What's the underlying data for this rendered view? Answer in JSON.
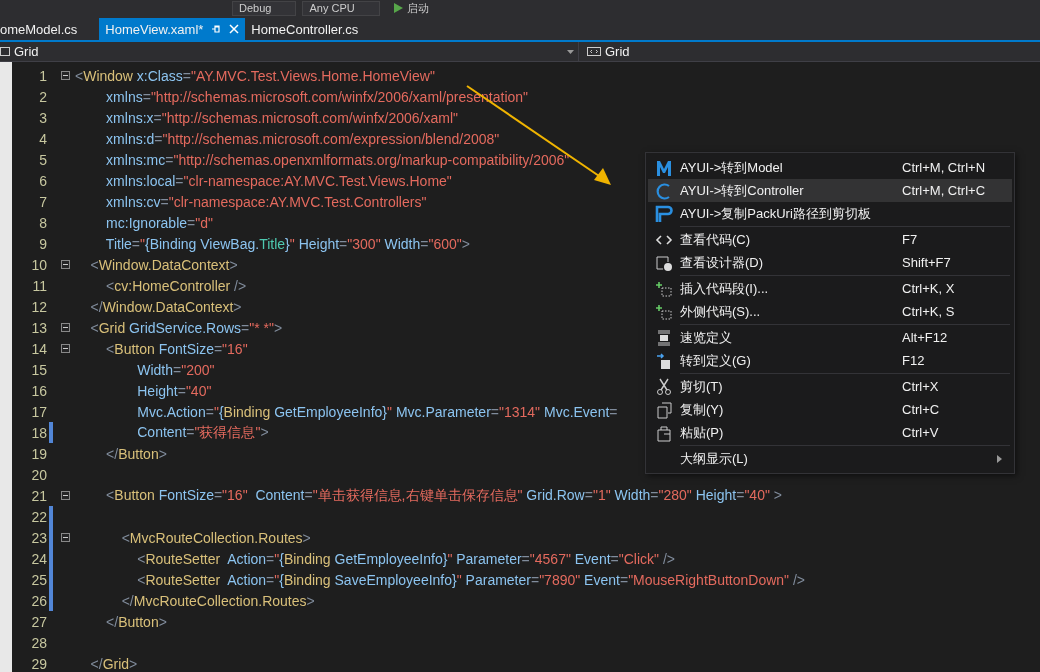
{
  "toolbar": {
    "items": [
      {
        "kind": "dropdown",
        "label": "Debug"
      },
      {
        "kind": "dropdown",
        "label": "Any CPU"
      },
      {
        "kind": "run",
        "label": "启动"
      }
    ]
  },
  "tabs": [
    {
      "label": "omeModel.cs",
      "selected": false
    },
    {
      "label": "HomeView.xaml*",
      "selected": true
    },
    {
      "label": "HomeController.cs",
      "selected": false
    }
  ],
  "breadcrumb": {
    "left": "Grid",
    "right": "Grid"
  },
  "code_lines": [
    {
      "num": "1",
      "fold": true,
      "changed": false,
      "tokens": [
        {
          "kind": "punct",
          "text": "<"
        },
        {
          "kind": "tag",
          "text": "Window"
        },
        {
          "kind": "attr",
          "text": " x:Class"
        },
        {
          "kind": "punct",
          "text": "="
        },
        {
          "kind": "value",
          "text": "\"AY.MVC.Test.Views.Home.HomeView\""
        }
      ]
    },
    {
      "num": "2",
      "fold": false,
      "changed": false,
      "tokens": [
        {
          "kind": "attr",
          "text": "        xmlns"
        },
        {
          "kind": "punct",
          "text": "="
        },
        {
          "kind": "value",
          "text": "\"http://schemas.microsoft.com/winfx/2006/xaml/presentation\""
        }
      ]
    },
    {
      "num": "3",
      "fold": false,
      "changed": false,
      "tokens": [
        {
          "kind": "attr",
          "text": "        xmlns:x"
        },
        {
          "kind": "punct",
          "text": "="
        },
        {
          "kind": "value",
          "text": "\"http://schemas.microsoft.com/winfx/2006/xaml\""
        }
      ]
    },
    {
      "num": "4",
      "fold": false,
      "changed": false,
      "tokens": [
        {
          "kind": "attr",
          "text": "        xmlns:d"
        },
        {
          "kind": "punct",
          "text": "="
        },
        {
          "kind": "value",
          "text": "\"http://schemas.microsoft.com/expression/blend/2008\""
        }
      ]
    },
    {
      "num": "5",
      "fold": false,
      "changed": false,
      "tokens": [
        {
          "kind": "attr",
          "text": "        xmlns:mc"
        },
        {
          "kind": "punct",
          "text": "="
        },
        {
          "kind": "value",
          "text": "\"http://schemas.openxmlformats.org/markup-compatibility/2006\""
        }
      ]
    },
    {
      "num": "6",
      "fold": false,
      "changed": false,
      "tokens": [
        {
          "kind": "attr",
          "text": "        xmlns:local"
        },
        {
          "kind": "punct",
          "text": "="
        },
        {
          "kind": "value",
          "text": "\"clr-namespace:AY.MVC.Test.Views.Home\""
        }
      ]
    },
    {
      "num": "7",
      "fold": false,
      "changed": false,
      "tokens": [
        {
          "kind": "attr",
          "text": "        xmlns:cv"
        },
        {
          "kind": "punct",
          "text": "="
        },
        {
          "kind": "value",
          "text": "\"clr-namespace:AY.MVC.Test.Controllers\""
        }
      ]
    },
    {
      "num": "8",
      "fold": false,
      "changed": false,
      "tokens": [
        {
          "kind": "attr",
          "text": "        mc:Ignorable"
        },
        {
          "kind": "punct",
          "text": "="
        },
        {
          "kind": "value",
          "text": "\"d\""
        }
      ]
    },
    {
      "num": "9",
      "fold": false,
      "changed": false,
      "tokens": [
        {
          "kind": "attr",
          "text": "        Title"
        },
        {
          "kind": "punct",
          "text": "="
        },
        {
          "kind": "value",
          "text": "\""
        },
        {
          "kind": "attr",
          "text": "{Binding ViewBag."
        },
        {
          "kind": "ext",
          "text": "Title"
        },
        {
          "kind": "attr",
          "text": "}"
        },
        {
          "kind": "value",
          "text": "\""
        },
        {
          "kind": "attr",
          "text": " Height"
        },
        {
          "kind": "punct",
          "text": "="
        },
        {
          "kind": "value",
          "text": "\"300\""
        },
        {
          "kind": "attr",
          "text": " Width"
        },
        {
          "kind": "punct",
          "text": "="
        },
        {
          "kind": "value",
          "text": "\"600\""
        },
        {
          "kind": "punct",
          "text": ">"
        }
      ]
    },
    {
      "num": "10",
      "fold": true,
      "changed": false,
      "tokens": [
        {
          "kind": "punct",
          "text": "    <"
        },
        {
          "kind": "tag",
          "text": "Window.DataContext"
        },
        {
          "kind": "punct",
          "text": ">"
        }
      ]
    },
    {
      "num": "11",
      "fold": false,
      "changed": false,
      "tokens": [
        {
          "kind": "punct",
          "text": "        <"
        },
        {
          "kind": "tag",
          "text": "cv:HomeController"
        },
        {
          "kind": "punct",
          "text": " />"
        }
      ]
    },
    {
      "num": "12",
      "fold": false,
      "changed": false,
      "tokens": [
        {
          "kind": "punct",
          "text": "    </"
        },
        {
          "kind": "tag",
          "text": "Window.DataContext"
        },
        {
          "kind": "punct",
          "text": ">"
        }
      ]
    },
    {
      "num": "13",
      "fold": true,
      "changed": false,
      "tokens": [
        {
          "kind": "punct",
          "text": "    <"
        },
        {
          "kind": "tag",
          "text": "Grid"
        },
        {
          "kind": "attr",
          "text": " GridService.Rows"
        },
        {
          "kind": "punct",
          "text": "="
        },
        {
          "kind": "value",
          "text": "\"* *\""
        },
        {
          "kind": "punct",
          "text": ">"
        }
      ]
    },
    {
      "num": "14",
      "fold": true,
      "changed": false,
      "tokens": [
        {
          "kind": "punct",
          "text": "        <"
        },
        {
          "kind": "tag",
          "text": "Button"
        },
        {
          "kind": "attr",
          "text": " FontSize"
        },
        {
          "kind": "punct",
          "text": "="
        },
        {
          "kind": "value",
          "text": "\"16\""
        }
      ]
    },
    {
      "num": "15",
      "fold": false,
      "changed": false,
      "tokens": [
        {
          "kind": "attr",
          "text": "                Width"
        },
        {
          "kind": "punct",
          "text": "="
        },
        {
          "kind": "value",
          "text": "\"200\""
        }
      ]
    },
    {
      "num": "16",
      "fold": false,
      "changed": false,
      "tokens": [
        {
          "kind": "attr",
          "text": "                Height"
        },
        {
          "kind": "punct",
          "text": "="
        },
        {
          "kind": "value",
          "text": "\"40\""
        }
      ]
    },
    {
      "num": "17",
      "fold": false,
      "changed": false,
      "tokens": [
        {
          "kind": "attr",
          "text": "                Mvc.Action"
        },
        {
          "kind": "punct",
          "text": "="
        },
        {
          "kind": "value",
          "text": "\""
        },
        {
          "kind": "attr",
          "text": "{"
        },
        {
          "kind": "tag",
          "text": "Binding"
        },
        {
          "kind": "attr",
          "text": " GetEmployeeInfo}"
        },
        {
          "kind": "value",
          "text": "\""
        },
        {
          "kind": "attr",
          "text": " Mvc.Parameter"
        },
        {
          "kind": "punct",
          "text": "="
        },
        {
          "kind": "value",
          "text": "\"1314\""
        },
        {
          "kind": "attr",
          "text": " Mvc.Event"
        },
        {
          "kind": "punct",
          "text": "="
        }
      ]
    },
    {
      "num": "18",
      "fold": false,
      "changed": true,
      "tokens": [
        {
          "kind": "attr",
          "text": "                Content"
        },
        {
          "kind": "punct",
          "text": "="
        },
        {
          "kind": "value",
          "text": "\"获得信息\""
        },
        {
          "kind": "punct",
          "text": ">"
        }
      ]
    },
    {
      "num": "19",
      "fold": false,
      "changed": false,
      "tokens": [
        {
          "kind": "punct",
          "text": "        </"
        },
        {
          "kind": "tag",
          "text": "Button"
        },
        {
          "kind": "punct",
          "text": ">"
        }
      ]
    },
    {
      "num": "20",
      "fold": false,
      "changed": false
    },
    {
      "num": "21",
      "fold": true,
      "changed": false,
      "tokens": [
        {
          "kind": "punct",
          "text": "        <"
        },
        {
          "kind": "tag",
          "text": "Button"
        },
        {
          "kind": "attr",
          "text": " FontSize"
        },
        {
          "kind": "punct",
          "text": "="
        },
        {
          "kind": "value",
          "text": "\"16\""
        },
        {
          "kind": "attr",
          "text": "  Content"
        },
        {
          "kind": "punct",
          "text": "="
        },
        {
          "kind": "value",
          "text": "\"单击获得信息,右键单击保存信息\""
        },
        {
          "kind": "attr",
          "text": " Grid.Row"
        },
        {
          "kind": "punct",
          "text": "="
        },
        {
          "kind": "value",
          "text": "\"1\""
        },
        {
          "kind": "attr",
          "text": " Width"
        },
        {
          "kind": "punct",
          "text": "="
        },
        {
          "kind": "value",
          "text": "\"280\""
        },
        {
          "kind": "attr",
          "text": " Height"
        },
        {
          "kind": "punct",
          "text": "="
        },
        {
          "kind": "value",
          "text": "\"40\""
        },
        {
          "kind": "punct",
          "text": " >"
        }
      ]
    },
    {
      "num": "22",
      "fold": false,
      "changed": true
    },
    {
      "num": "23",
      "fold": true,
      "changed": true,
      "tokens": [
        {
          "kind": "punct",
          "text": "            <"
        },
        {
          "kind": "tag",
          "text": "MvcRouteCollection.Routes"
        },
        {
          "kind": "punct",
          "text": ">"
        }
      ]
    },
    {
      "num": "24",
      "fold": false,
      "changed": true,
      "tokens": [
        {
          "kind": "punct",
          "text": "                <"
        },
        {
          "kind": "tag",
          "text": "RouteSetter"
        },
        {
          "kind": "attr",
          "text": "  Action"
        },
        {
          "kind": "punct",
          "text": "="
        },
        {
          "kind": "value",
          "text": "\""
        },
        {
          "kind": "attr",
          "text": "{"
        },
        {
          "kind": "tag",
          "text": "Binding"
        },
        {
          "kind": "attr",
          "text": " GetEmployeeInfo}"
        },
        {
          "kind": "value",
          "text": "\""
        },
        {
          "kind": "attr",
          "text": " Parameter"
        },
        {
          "kind": "punct",
          "text": "="
        },
        {
          "kind": "value",
          "text": "\"4567\""
        },
        {
          "kind": "attr",
          "text": " Event"
        },
        {
          "kind": "punct",
          "text": "="
        },
        {
          "kind": "value",
          "text": "\"Click\""
        },
        {
          "kind": "punct",
          "text": " />"
        }
      ]
    },
    {
      "num": "25",
      "fold": false,
      "changed": true,
      "tokens": [
        {
          "kind": "punct",
          "text": "                <"
        },
        {
          "kind": "tag",
          "text": "RouteSetter"
        },
        {
          "kind": "attr",
          "text": "  Action"
        },
        {
          "kind": "punct",
          "text": "="
        },
        {
          "kind": "value",
          "text": "\""
        },
        {
          "kind": "attr",
          "text": "{"
        },
        {
          "kind": "tag",
          "text": "Binding"
        },
        {
          "kind": "attr",
          "text": " SaveEmployeeInfo}"
        },
        {
          "kind": "value",
          "text": "\""
        },
        {
          "kind": "attr",
          "text": " Parameter"
        },
        {
          "kind": "punct",
          "text": "="
        },
        {
          "kind": "value",
          "text": "\"7890\""
        },
        {
          "kind": "attr",
          "text": " Event"
        },
        {
          "kind": "punct",
          "text": "="
        },
        {
          "kind": "value",
          "text": "\"MouseRightButtonDown\""
        },
        {
          "kind": "punct",
          "text": " />"
        }
      ]
    },
    {
      "num": "26",
      "fold": false,
      "changed": true,
      "tokens": [
        {
          "kind": "punct",
          "text": "            </"
        },
        {
          "kind": "tag",
          "text": "MvcRouteCollection.Routes"
        },
        {
          "kind": "punct",
          "text": ">"
        }
      ]
    },
    {
      "num": "27",
      "fold": false,
      "changed": false,
      "tokens": [
        {
          "kind": "punct",
          "text": "        </"
        },
        {
          "kind": "tag",
          "text": "Button"
        },
        {
          "kind": "punct",
          "text": ">"
        }
      ]
    },
    {
      "num": "28",
      "fold": false,
      "changed": false
    },
    {
      "num": "29",
      "fold": false,
      "changed": false,
      "tokens": [
        {
          "kind": "punct",
          "text": "    </"
        },
        {
          "kind": "tag",
          "text": "Grid"
        },
        {
          "kind": "punct",
          "text": ">"
        }
      ]
    }
  ],
  "context_menu": {
    "groups": [
      [
        {
          "label": "AYUI->转到Model",
          "shortcut": "Ctrl+M, Ctrl+N",
          "selected": false,
          "submenu": false
        },
        {
          "label": "AYUI->转到Controller",
          "shortcut": "Ctrl+M, Ctrl+C",
          "selected": true,
          "submenu": false
        },
        {
          "label": "AYUI->复制PackUri路径到剪切板",
          "selected": false,
          "submenu": false
        }
      ],
      [
        {
          "label": "查看代码(C)",
          "shortcut": "F7",
          "selected": false,
          "submenu": false
        },
        {
          "label": "查看设计器(D)",
          "shortcut": "Shift+F7",
          "selected": false,
          "submenu": false
        }
      ],
      [
        {
          "label": "插入代码段(I)...",
          "shortcut": "Ctrl+K, X",
          "selected": false,
          "submenu": false
        },
        {
          "label": "外侧代码(S)...",
          "shortcut": "Ctrl+K, S",
          "selected": false,
          "submenu": false
        }
      ],
      [
        {
          "label": "速览定义",
          "shortcut": "Alt+F12",
          "selected": false,
          "submenu": false
        },
        {
          "label": "转到定义(G)",
          "shortcut": "F12",
          "selected": false,
          "submenu": false
        }
      ],
      [
        {
          "label": "剪切(T)",
          "shortcut": "Ctrl+X",
          "selected": false,
          "submenu": false
        },
        {
          "label": "复制(Y)",
          "shortcut": "Ctrl+C",
          "selected": false,
          "submenu": false
        },
        {
          "label": "粘贴(P)",
          "shortcut": "Ctrl+V",
          "selected": false,
          "submenu": false
        }
      ],
      [
        {
          "label": "大纲显示(L)",
          "selected": false,
          "submenu": true
        }
      ]
    ]
  }
}
